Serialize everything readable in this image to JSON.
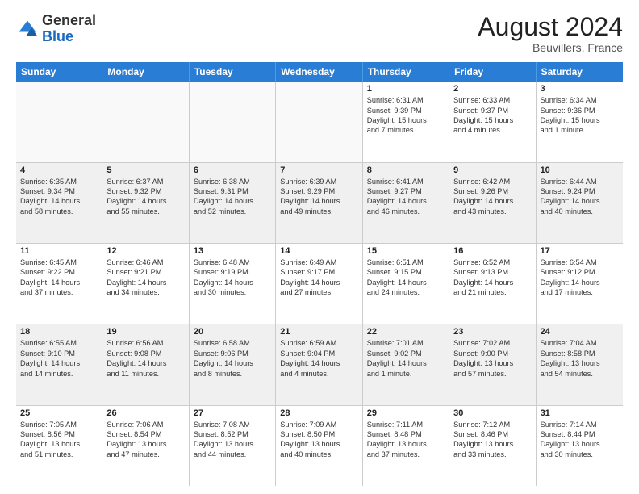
{
  "header": {
    "logo_general": "General",
    "logo_blue": "Blue",
    "month_title": "August 2024",
    "location": "Beuvillers, France"
  },
  "days_of_week": [
    "Sunday",
    "Monday",
    "Tuesday",
    "Wednesday",
    "Thursday",
    "Friday",
    "Saturday"
  ],
  "weeks": [
    [
      {
        "day": "",
        "lines": []
      },
      {
        "day": "",
        "lines": []
      },
      {
        "day": "",
        "lines": []
      },
      {
        "day": "",
        "lines": []
      },
      {
        "day": "1",
        "lines": [
          "Sunrise: 6:31 AM",
          "Sunset: 9:39 PM",
          "Daylight: 15 hours",
          "and 7 minutes."
        ]
      },
      {
        "day": "2",
        "lines": [
          "Sunrise: 6:33 AM",
          "Sunset: 9:37 PM",
          "Daylight: 15 hours",
          "and 4 minutes."
        ]
      },
      {
        "day": "3",
        "lines": [
          "Sunrise: 6:34 AM",
          "Sunset: 9:36 PM",
          "Daylight: 15 hours",
          "and 1 minute."
        ]
      }
    ],
    [
      {
        "day": "4",
        "lines": [
          "Sunrise: 6:35 AM",
          "Sunset: 9:34 PM",
          "Daylight: 14 hours",
          "and 58 minutes."
        ]
      },
      {
        "day": "5",
        "lines": [
          "Sunrise: 6:37 AM",
          "Sunset: 9:32 PM",
          "Daylight: 14 hours",
          "and 55 minutes."
        ]
      },
      {
        "day": "6",
        "lines": [
          "Sunrise: 6:38 AM",
          "Sunset: 9:31 PM",
          "Daylight: 14 hours",
          "and 52 minutes."
        ]
      },
      {
        "day": "7",
        "lines": [
          "Sunrise: 6:39 AM",
          "Sunset: 9:29 PM",
          "Daylight: 14 hours",
          "and 49 minutes."
        ]
      },
      {
        "day": "8",
        "lines": [
          "Sunrise: 6:41 AM",
          "Sunset: 9:27 PM",
          "Daylight: 14 hours",
          "and 46 minutes."
        ]
      },
      {
        "day": "9",
        "lines": [
          "Sunrise: 6:42 AM",
          "Sunset: 9:26 PM",
          "Daylight: 14 hours",
          "and 43 minutes."
        ]
      },
      {
        "day": "10",
        "lines": [
          "Sunrise: 6:44 AM",
          "Sunset: 9:24 PM",
          "Daylight: 14 hours",
          "and 40 minutes."
        ]
      }
    ],
    [
      {
        "day": "11",
        "lines": [
          "Sunrise: 6:45 AM",
          "Sunset: 9:22 PM",
          "Daylight: 14 hours",
          "and 37 minutes."
        ]
      },
      {
        "day": "12",
        "lines": [
          "Sunrise: 6:46 AM",
          "Sunset: 9:21 PM",
          "Daylight: 14 hours",
          "and 34 minutes."
        ]
      },
      {
        "day": "13",
        "lines": [
          "Sunrise: 6:48 AM",
          "Sunset: 9:19 PM",
          "Daylight: 14 hours",
          "and 30 minutes."
        ]
      },
      {
        "day": "14",
        "lines": [
          "Sunrise: 6:49 AM",
          "Sunset: 9:17 PM",
          "Daylight: 14 hours",
          "and 27 minutes."
        ]
      },
      {
        "day": "15",
        "lines": [
          "Sunrise: 6:51 AM",
          "Sunset: 9:15 PM",
          "Daylight: 14 hours",
          "and 24 minutes."
        ]
      },
      {
        "day": "16",
        "lines": [
          "Sunrise: 6:52 AM",
          "Sunset: 9:13 PM",
          "Daylight: 14 hours",
          "and 21 minutes."
        ]
      },
      {
        "day": "17",
        "lines": [
          "Sunrise: 6:54 AM",
          "Sunset: 9:12 PM",
          "Daylight: 14 hours",
          "and 17 minutes."
        ]
      }
    ],
    [
      {
        "day": "18",
        "lines": [
          "Sunrise: 6:55 AM",
          "Sunset: 9:10 PM",
          "Daylight: 14 hours",
          "and 14 minutes."
        ]
      },
      {
        "day": "19",
        "lines": [
          "Sunrise: 6:56 AM",
          "Sunset: 9:08 PM",
          "Daylight: 14 hours",
          "and 11 minutes."
        ]
      },
      {
        "day": "20",
        "lines": [
          "Sunrise: 6:58 AM",
          "Sunset: 9:06 PM",
          "Daylight: 14 hours",
          "and 8 minutes."
        ]
      },
      {
        "day": "21",
        "lines": [
          "Sunrise: 6:59 AM",
          "Sunset: 9:04 PM",
          "Daylight: 14 hours",
          "and 4 minutes."
        ]
      },
      {
        "day": "22",
        "lines": [
          "Sunrise: 7:01 AM",
          "Sunset: 9:02 PM",
          "Daylight: 14 hours",
          "and 1 minute."
        ]
      },
      {
        "day": "23",
        "lines": [
          "Sunrise: 7:02 AM",
          "Sunset: 9:00 PM",
          "Daylight: 13 hours",
          "and 57 minutes."
        ]
      },
      {
        "day": "24",
        "lines": [
          "Sunrise: 7:04 AM",
          "Sunset: 8:58 PM",
          "Daylight: 13 hours",
          "and 54 minutes."
        ]
      }
    ],
    [
      {
        "day": "25",
        "lines": [
          "Sunrise: 7:05 AM",
          "Sunset: 8:56 PM",
          "Daylight: 13 hours",
          "and 51 minutes."
        ]
      },
      {
        "day": "26",
        "lines": [
          "Sunrise: 7:06 AM",
          "Sunset: 8:54 PM",
          "Daylight: 13 hours",
          "and 47 minutes."
        ]
      },
      {
        "day": "27",
        "lines": [
          "Sunrise: 7:08 AM",
          "Sunset: 8:52 PM",
          "Daylight: 13 hours",
          "and 44 minutes."
        ]
      },
      {
        "day": "28",
        "lines": [
          "Sunrise: 7:09 AM",
          "Sunset: 8:50 PM",
          "Daylight: 13 hours",
          "and 40 minutes."
        ]
      },
      {
        "day": "29",
        "lines": [
          "Sunrise: 7:11 AM",
          "Sunset: 8:48 PM",
          "Daylight: 13 hours",
          "and 37 minutes."
        ]
      },
      {
        "day": "30",
        "lines": [
          "Sunrise: 7:12 AM",
          "Sunset: 8:46 PM",
          "Daylight: 13 hours",
          "and 33 minutes."
        ]
      },
      {
        "day": "31",
        "lines": [
          "Sunrise: 7:14 AM",
          "Sunset: 8:44 PM",
          "Daylight: 13 hours",
          "and 30 minutes."
        ]
      }
    ]
  ]
}
